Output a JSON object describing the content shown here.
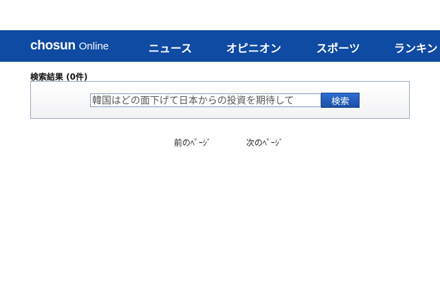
{
  "header": {
    "logo_main": "chosun",
    "logo_sub": "Online",
    "nav": [
      "ニュース",
      "オピニオン",
      "スポーツ",
      "ランキン"
    ]
  },
  "search": {
    "result_title": "検索結果 (0件)",
    "query": "韓国はどの面下げて日本からの投資を期待して",
    "button_label": "検索"
  },
  "pagination": {
    "prev": "前のﾍﾟｰｼﾞ",
    "next": "次のﾍﾟｰｼﾞ"
  },
  "colors": {
    "navbar": "#0f4aa3",
    "button": "#1a4fa8",
    "box_border": "#9aa9bd"
  }
}
